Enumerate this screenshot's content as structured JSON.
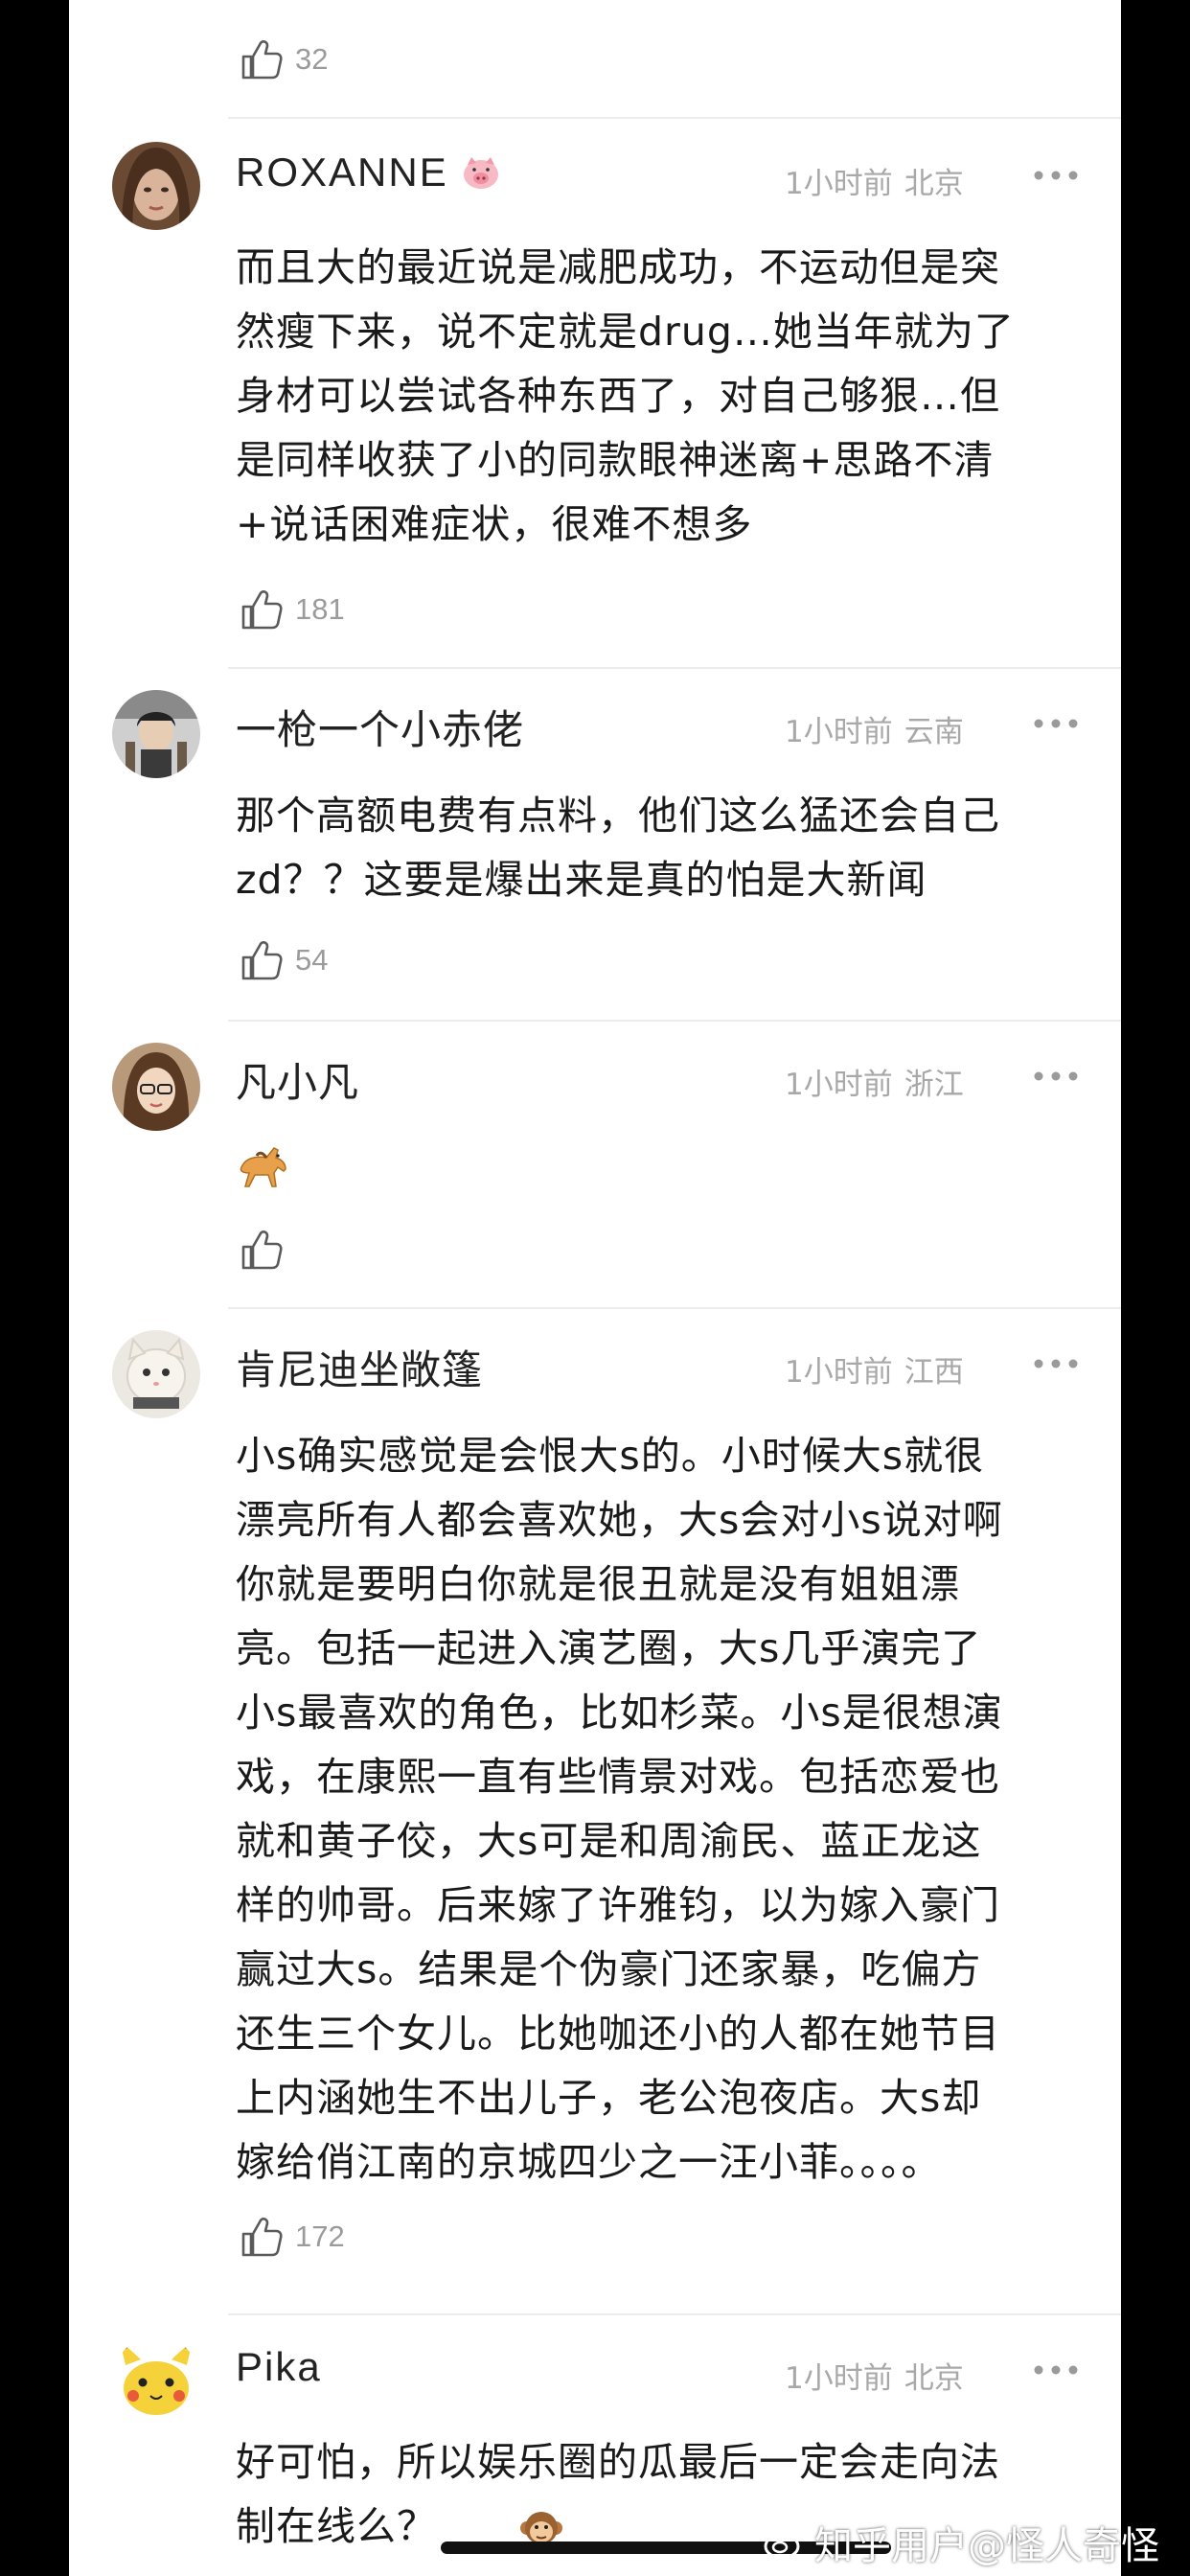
{
  "prev_comment": {
    "like_count": "32"
  },
  "comments": [
    {
      "username": "ROXANNE",
      "badge": "pig-emoji",
      "time": "1小时前",
      "location": "北京",
      "text": "而且大的最近说是减肥成功，不运动但是突\n然瘦下来，说不定就是drug…她当年就为了\n身材可以尝试各种东西了，对自己够狠…但\n是同样收获了小的同款眼神迷离+思路不清\n+说话困难症状，很难不想多",
      "like_count": "181"
    },
    {
      "username": "一枪一个小赤佬",
      "time": "1小时前",
      "location": "云南",
      "text": "那个高额电费有点料，他们这么猛还会自己\nzd？？这要是爆出来是真的怕是大新闻",
      "like_count": "54"
    },
    {
      "username": "凡小凡",
      "time": "1小时前",
      "location": "浙江",
      "text": "",
      "emoji": "horse-emoji",
      "like_count": ""
    },
    {
      "username": "肯尼迪坐敞篷",
      "time": "1小时前",
      "location": "江西",
      "text": "小s确实感觉是会恨大s的。小时候大s就很\n漂亮所有人都会喜欢她，大s会对小s说对啊\n你就是要明白你就是很丑就是没有姐姐漂\n亮。包括一起进入演艺圈，大s几乎演完了\n小s最喜欢的角色，比如杉菜。小s是很想演\n戏，在康熙一直有些情景对戏。包括恋爱也\n就和黄子佼，大s可是和周渝民、蓝正龙这\n样的帅哥。后来嫁了许雅钧，以为嫁入豪门\n赢过大s。结果是个伪豪门还家暴，吃偏方\n还生三个女儿。比她咖还小的人都在她节目\n上内涵她生不出儿子，老公泡夜店。大s却\n嫁给俏江南的京城四少之一汪小菲。。。。",
      "like_count": "172"
    },
    {
      "username": "Pika",
      "time": "1小时前",
      "location": "北京",
      "text": "好可怕，所以娱乐圈的瓜最后一定会走向法\n制在线么？",
      "emoji": "monkey-emoji"
    }
  ],
  "watermark": {
    "text": "知乎用户@怪人奇怪"
  },
  "colors": {
    "background": "#ffffff",
    "outer": "#000000",
    "text": "#1a1a1a",
    "meta": "#a8a8a8",
    "divider": "#ececec"
  }
}
